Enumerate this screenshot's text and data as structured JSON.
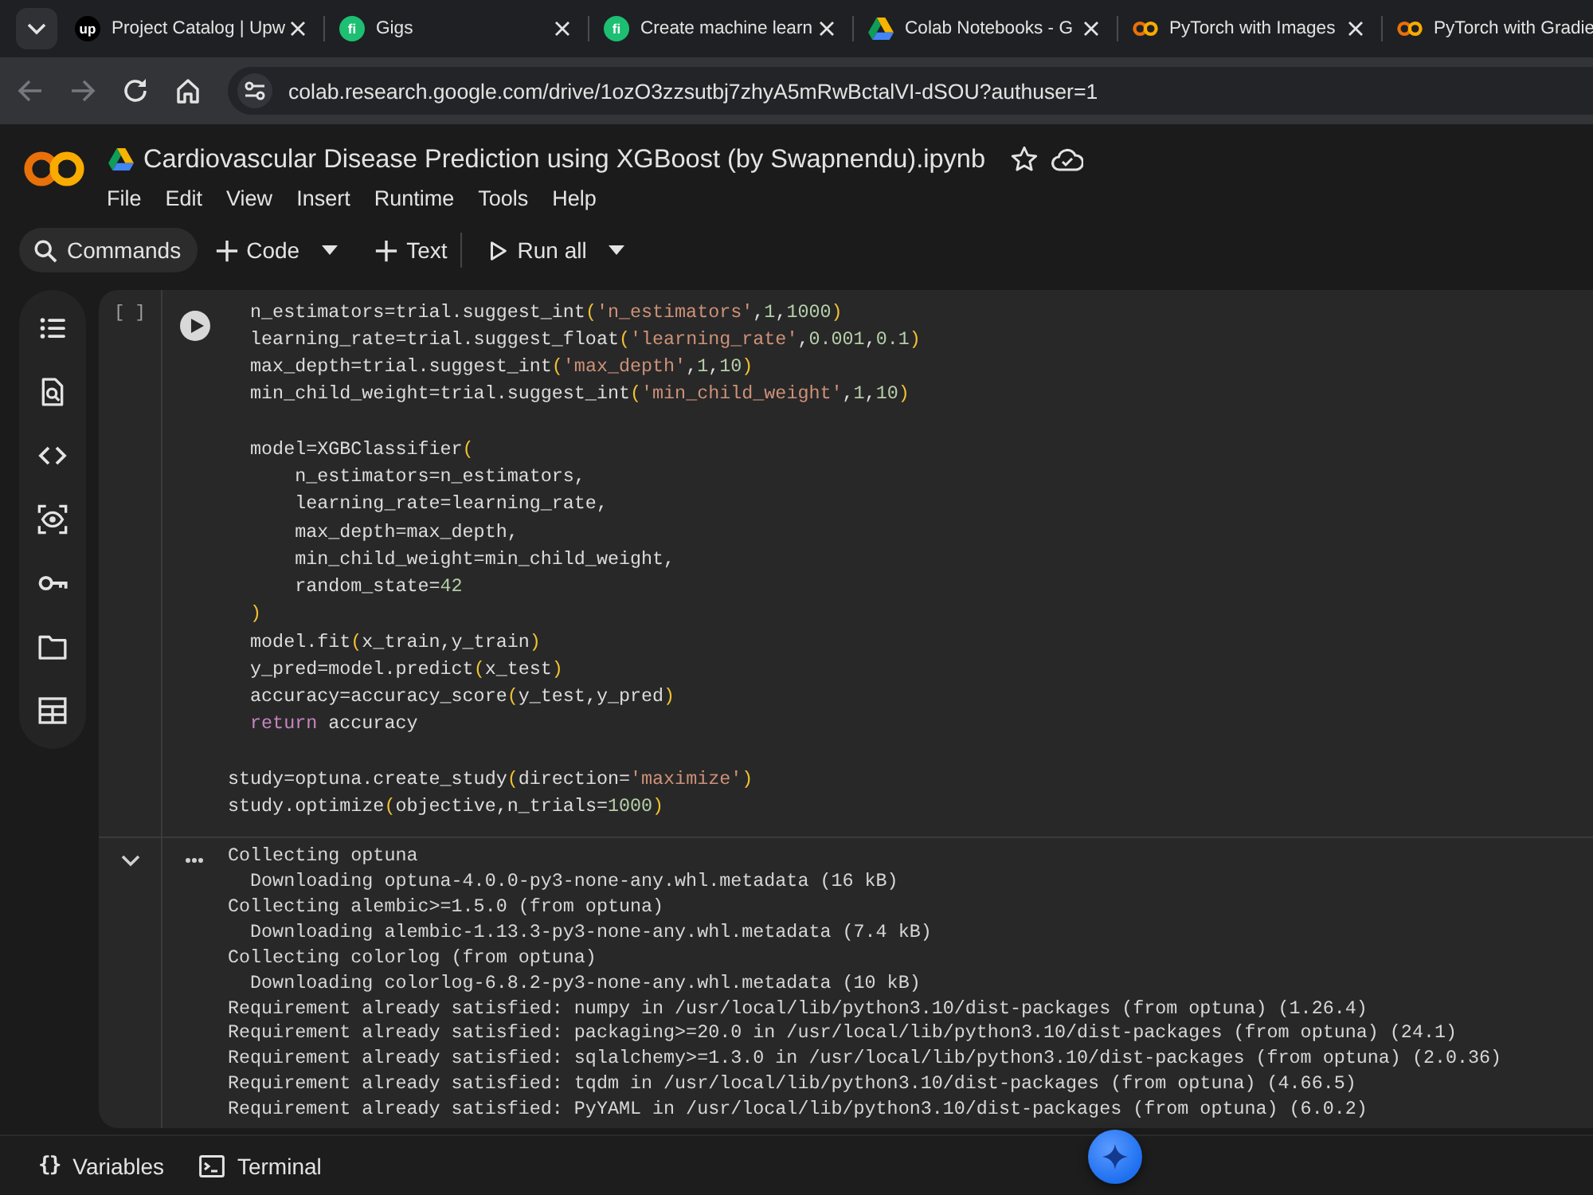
{
  "browser": {
    "tabs": [
      {
        "title": "Project Catalog | Upw",
        "selected": false,
        "icon": {
          "kind": "letters",
          "text": "up",
          "color": "#000000"
        }
      },
      {
        "title": "Gigs",
        "selected": false,
        "icon": {
          "kind": "letters",
          "text": "fi",
          "color": "#1dbf73"
        }
      },
      {
        "title": "Create machine learn",
        "selected": false,
        "icon": {
          "kind": "letters",
          "text": "fi",
          "color": "#1dbf73"
        }
      },
      {
        "title": "Colab Notebooks - G",
        "selected": false,
        "icon": {
          "kind": "triangle"
        }
      },
      {
        "title": "PyTorch with Images",
        "selected": false,
        "icon": {
          "kind": "rings"
        }
      },
      {
        "title": "PyTorch with Gradie",
        "selected": false,
        "icon": {
          "kind": "rings"
        }
      }
    ],
    "back_disabled": true,
    "forward_disabled": true,
    "url": "colab.research.google.com/drive/1ozO3zzsutbj7zhyA5mRwBctalVI-dSOU?authuser=1"
  },
  "notebook": {
    "title": "Cardiovascular Disease Prediction using XGBoost (by Swapnendu).ipynb",
    "starred": false,
    "menu": [
      "File",
      "Edit",
      "View",
      "Insert",
      "Runtime",
      "Tools",
      "Help"
    ],
    "toolbar": [
      {
        "kind": "search",
        "label": "Commands"
      },
      {
        "kind": "add",
        "label": "Code"
      },
      {
        "kind": "caret"
      },
      {
        "kind": "add",
        "label": "Text"
      },
      {
        "kind": "separator"
      },
      {
        "kind": "run",
        "label": "Run all"
      },
      {
        "kind": "caret"
      }
    ]
  },
  "cell": {
    "execution_label": "[ ]",
    "code_blocks": [
      [
        [
          {
            "kind": "plain",
            "text": "  n_estimators=trial.suggest_int"
          },
          {
            "kind": "bracket",
            "text": "("
          },
          {
            "kind": "string",
            "text": "'n_estimators'"
          },
          {
            "kind": "plain",
            "text": ","
          },
          {
            "kind": "number",
            "text": "1"
          },
          {
            "kind": "plain",
            "text": ","
          },
          {
            "kind": "number",
            "text": "1000"
          },
          {
            "kind": "bracket",
            "text": ")"
          }
        ],
        [
          {
            "kind": "plain",
            "text": "  learning_rate=trial.suggest_float"
          },
          {
            "kind": "bracket",
            "text": "("
          },
          {
            "kind": "string",
            "text": "'learning_rate'"
          },
          {
            "kind": "plain",
            "text": ","
          },
          {
            "kind": "number",
            "text": "0.001"
          },
          {
            "kind": "plain",
            "text": ","
          },
          {
            "kind": "number",
            "text": "0.1"
          },
          {
            "kind": "bracket",
            "text": ")"
          }
        ],
        [
          {
            "kind": "plain",
            "text": "  max_depth=trial.suggest_int"
          },
          {
            "kind": "bracket",
            "text": "("
          },
          {
            "kind": "string",
            "text": "'max_depth'"
          },
          {
            "kind": "plain",
            "text": ","
          },
          {
            "kind": "number",
            "text": "1"
          },
          {
            "kind": "plain",
            "text": ","
          },
          {
            "kind": "number",
            "text": "10"
          },
          {
            "kind": "bracket",
            "text": ")"
          }
        ],
        [
          {
            "kind": "plain",
            "text": "  min_child_weight=trial.suggest_int"
          },
          {
            "kind": "bracket",
            "text": "("
          },
          {
            "kind": "string",
            "text": "'min_child_weight'"
          },
          {
            "kind": "plain",
            "text": ","
          },
          {
            "kind": "number",
            "text": "1"
          },
          {
            "kind": "plain",
            "text": ","
          },
          {
            "kind": "number",
            "text": "10"
          },
          {
            "kind": "bracket",
            "text": ")"
          }
        ]
      ],
      [
        [
          {
            "kind": "plain",
            "text": "  model=XGBClassifier"
          },
          {
            "kind": "bracket",
            "text": "("
          }
        ],
        [
          {
            "kind": "plain",
            "text": "      n_estimators=n_estimators,"
          }
        ],
        [
          {
            "kind": "plain",
            "text": "      learning_rate=learning_rate,"
          }
        ],
        [
          {
            "kind": "plain",
            "text": "      max_depth=max_depth,"
          }
        ],
        [
          {
            "kind": "plain",
            "text": "      min_child_weight=min_child_weight,"
          }
        ],
        [
          {
            "kind": "plain",
            "text": "      random_state="
          },
          {
            "kind": "number",
            "text": "42"
          }
        ],
        [
          {
            "kind": "bracket",
            "text": "  )"
          }
        ],
        [
          {
            "kind": "plain",
            "text": "  model.fit"
          },
          {
            "kind": "bracket",
            "text": "("
          },
          {
            "kind": "plain",
            "text": "x_train,y_train"
          },
          {
            "kind": "bracket",
            "text": ")"
          }
        ],
        [
          {
            "kind": "plain",
            "text": "  y_pred=model.predict"
          },
          {
            "kind": "bracket",
            "text": "("
          },
          {
            "kind": "plain",
            "text": "x_test"
          },
          {
            "kind": "bracket",
            "text": ")"
          }
        ],
        [
          {
            "kind": "plain",
            "text": "  accuracy=accuracy_score"
          },
          {
            "kind": "bracket",
            "text": "("
          },
          {
            "kind": "plain",
            "text": "y_test,y_pred"
          },
          {
            "kind": "bracket",
            "text": ")"
          }
        ],
        [
          {
            "kind": "keyword",
            "text": "  return"
          },
          {
            "kind": "plain",
            "text": " accuracy"
          }
        ]
      ],
      [
        [
          {
            "kind": "plain",
            "text": "study=optuna.create_study"
          },
          {
            "kind": "bracket",
            "text": "("
          },
          {
            "kind": "plain",
            "text": "direction="
          },
          {
            "kind": "string",
            "text": "'maximize'"
          },
          {
            "kind": "bracket",
            "text": ")"
          }
        ],
        [
          {
            "kind": "plain",
            "text": "study.optimize"
          },
          {
            "kind": "bracket",
            "text": "("
          },
          {
            "kind": "plain",
            "text": "objective,n_trials="
          },
          {
            "kind": "number",
            "text": "1000"
          },
          {
            "kind": "bracket",
            "text": ")"
          }
        ]
      ]
    ],
    "output": {
      "expanded": true,
      "lines": [
        "Collecting optuna",
        "  Downloading optuna-4.0.0-py3-none-any.whl.metadata (16 kB)",
        "Collecting alembic>=1.5.0 (from optuna)",
        "  Downloading alembic-1.13.3-py3-none-any.whl.metadata (7.4 kB)",
        "Collecting colorlog (from optuna)",
        "  Downloading colorlog-6.8.2-py3-none-any.whl.metadata (10 kB)",
        "Requirement already satisfied: numpy in /usr/local/lib/python3.10/dist-packages (from optuna) (1.26.4)",
        "Requirement already satisfied: packaging>=20.0 in /usr/local/lib/python3.10/dist-packages (from optuna) (24.1)",
        "Requirement already satisfied: sqlalchemy>=1.3.0 in /usr/local/lib/python3.10/dist-packages (from optuna) (2.0.36)",
        "Requirement already satisfied: tqdm in /usr/local/lib/python3.10/dist-packages (from optuna) (4.66.5)",
        "Requirement already satisfied: PyYAML in /usr/local/lib/python3.10/dist-packages (from optuna) (6.0.2)"
      ]
    }
  },
  "status_bar": [
    {
      "kind": "glyph",
      "glyph": "{}",
      "label": "Variables"
    },
    {
      "kind": "terminal",
      "label": "Terminal"
    }
  ]
}
